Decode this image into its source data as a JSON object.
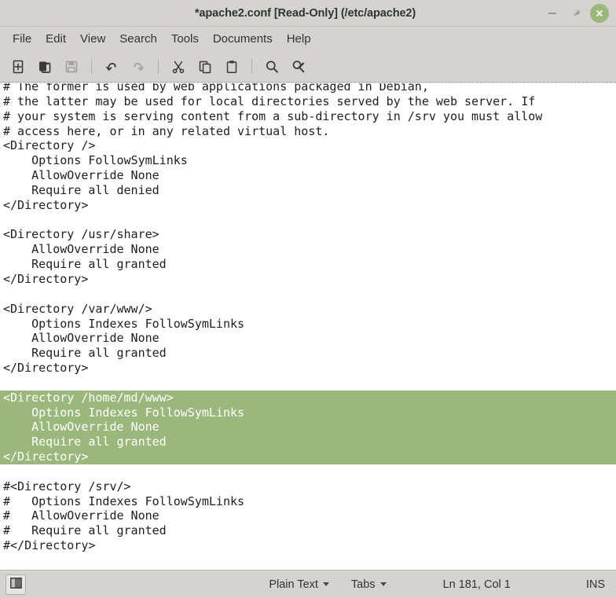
{
  "window": {
    "title": "*apache2.conf [Read-Only] (/etc/apache2)",
    "controls": {
      "minimize": "minimize",
      "maximize": "restore",
      "close": "close"
    },
    "close_button_color": "#9ab87b"
  },
  "menubar": {
    "items": [
      {
        "label": "File"
      },
      {
        "label": "Edit"
      },
      {
        "label": "View"
      },
      {
        "label": "Search"
      },
      {
        "label": "Tools"
      },
      {
        "label": "Documents"
      },
      {
        "label": "Help"
      }
    ]
  },
  "toolbar": {
    "buttons": [
      {
        "name": "new-document-icon",
        "title": "New",
        "enabled": true
      },
      {
        "name": "open-document-icon",
        "title": "Open",
        "enabled": true
      },
      {
        "name": "save-icon",
        "title": "Save",
        "enabled": false
      },
      {
        "name": "separator",
        "title": "",
        "enabled": true
      },
      {
        "name": "undo-icon",
        "title": "Undo",
        "enabled": true
      },
      {
        "name": "redo-icon",
        "title": "Redo",
        "enabled": false
      },
      {
        "name": "separator",
        "title": "",
        "enabled": true
      },
      {
        "name": "cut-icon",
        "title": "Cut",
        "enabled": true
      },
      {
        "name": "copy-icon",
        "title": "Copy",
        "enabled": true
      },
      {
        "name": "paste-icon",
        "title": "Paste",
        "enabled": true
      },
      {
        "name": "separator",
        "title": "",
        "enabled": true
      },
      {
        "name": "search-icon",
        "title": "Find",
        "enabled": true
      },
      {
        "name": "find-replace-icon",
        "title": "Find and Replace",
        "enabled": true
      }
    ]
  },
  "editor": {
    "selection_color": "#9ab87b",
    "selection_text_color": "#ffffff",
    "lines": [
      {
        "text": "# The former is used by web applications packaged in Debian,",
        "selected": false
      },
      {
        "text": "# the latter may be used for local directories served by the web server. If",
        "selected": false
      },
      {
        "text": "# your system is serving content from a sub-directory in /srv you must allow",
        "selected": false
      },
      {
        "text": "# access here, or in any related virtual host.",
        "selected": false
      },
      {
        "text": "<Directory />",
        "selected": false
      },
      {
        "text": "    Options FollowSymLinks",
        "selected": false
      },
      {
        "text": "    AllowOverride None",
        "selected": false
      },
      {
        "text": "    Require all denied",
        "selected": false
      },
      {
        "text": "</Directory>",
        "selected": false
      },
      {
        "text": "",
        "selected": false
      },
      {
        "text": "<Directory /usr/share>",
        "selected": false
      },
      {
        "text": "    AllowOverride None",
        "selected": false
      },
      {
        "text": "    Require all granted",
        "selected": false
      },
      {
        "text": "</Directory>",
        "selected": false
      },
      {
        "text": "",
        "selected": false
      },
      {
        "text": "<Directory /var/www/>",
        "selected": false
      },
      {
        "text": "    Options Indexes FollowSymLinks",
        "selected": false
      },
      {
        "text": "    AllowOverride None",
        "selected": false
      },
      {
        "text": "    Require all granted",
        "selected": false
      },
      {
        "text": "</Directory>",
        "selected": false
      },
      {
        "text": "",
        "selected": false
      },
      {
        "text": "<Directory /home/md/www>",
        "selected": true
      },
      {
        "text": "    Options Indexes FollowSymLinks",
        "selected": true
      },
      {
        "text": "    AllowOverride None",
        "selected": true
      },
      {
        "text": "    Require all granted",
        "selected": true
      },
      {
        "text": "</Directory>",
        "selected": true
      },
      {
        "text": "",
        "selected": false
      },
      {
        "text": "#<Directory /srv/>",
        "selected": false
      },
      {
        "text": "#   Options Indexes FollowSymLinks",
        "selected": false
      },
      {
        "text": "#   AllowOverride None",
        "selected": false
      },
      {
        "text": "#   Require all granted",
        "selected": false
      },
      {
        "text": "#</Directory>",
        "selected": false
      }
    ]
  },
  "statusbar": {
    "panel_toggle": "side-panel-toggle",
    "language": "Plain Text",
    "indent": "Tabs",
    "position": "Ln 181, Col 1",
    "insert_mode": "INS"
  }
}
